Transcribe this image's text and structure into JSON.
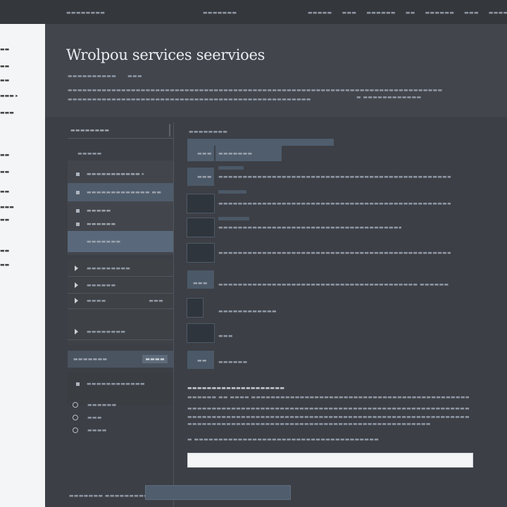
{
  "topbar": {
    "left": "▬▬▬▬▬▬▬▬",
    "center": "▬▬▬▬▬▬▬",
    "nav": [
      "▬▬▬▬▬",
      "▬▬▬",
      "▬▬▬▬▬▬",
      "▬▬",
      "▬▬▬▬▬▬",
      "▬▬▬",
      "▬▬▬▬▬▬▬"
    ]
  },
  "leftpane": {
    "items": [
      "▬▬",
      "▬▬",
      "▬▬",
      "▬▬▬ ▸",
      "▬▬▬",
      "▬▬",
      "▬▬",
      "▬▬",
      "▬▬▬",
      "▬▬",
      "▬▬",
      "▬▬"
    ]
  },
  "hero": {
    "title": "Wrolpou services seervioes",
    "meta1": "▬▬▬▬▬▬▬▬▬▬",
    "meta2": "▬▬▬",
    "para1": "▬▬▬▬▬▬▬▬▬▬▬▬▬▬▬▬▬▬▬▬▬▬▬▬▬▬▬▬▬▬▬▬▬▬▬▬▬▬▬▬▬▬▬▬▬▬▬▬▬▬▬▬▬▬▬▬▬▬▬▬▬▬▬▬▬▬▬▬▬▬▬▬▬▬▬▬▬",
    "para2": "▬▬▬▬▬▬▬▬▬▬▬▬▬▬▬▬▬▬▬▬▬▬▬▬▬▬▬▬▬▬▬▬▬▬▬▬▬▬▬▬▬▬▬▬▬▬▬▬▬▬",
    "para3": "▬ ▬▬▬▬▬▬▬▬▬▬▬▬"
  },
  "sidebar": {
    "header": "▬▬▬▬▬▬▬▬",
    "section": "▬▬▬▬▬",
    "items": [
      {
        "label": "▬▬▬▬▬▬▬▬▬▬▬ ▸"
      },
      {
        "label": "▬▬▬▬▬▬▬▬▬▬▬▬▬ ▬▬"
      },
      {
        "label": "▬▬▬▬▬"
      },
      {
        "label": "▬▬▬▬▬▬"
      },
      {
        "label": "▬▬▬▬▬▬▬"
      }
    ],
    "rows": [
      {
        "label": "▬▬▬▬▬▬▬▬▬",
        "right": ""
      },
      {
        "label": "▬▬▬▬▬▬",
        "right": ""
      },
      {
        "label": "▬▬▬▬",
        "right": "▬▬▬"
      },
      {
        "label": "▬▬▬▬▬▬▬▬",
        "right": ""
      }
    ],
    "button_left": "▬▬▬▬▬▬▬",
    "button_right": "▬▬▬▬",
    "sub": [
      {
        "label": "▬▬▬▬▬▬▬▬▬▬▬▬"
      },
      {
        "label": "▬▬▬▬▬▬"
      },
      {
        "label": "▬▬▬"
      },
      {
        "label": "▬▬▬▬"
      }
    ]
  },
  "content": {
    "title": "▬▬▬▬▬▬▬▬",
    "first_label": "▬▬▬▬▬▬▬",
    "first_thumb": "▬▬▬",
    "rows": [
      {
        "thumb": "▬▬▬",
        "label": "▬▬▬▬▬▬▬▬▬▬▬▬▬▬▬▬▬▬▬▬▬▬▬▬▬▬▬▬▬▬▬▬▬▬▬▬▬▬▬▬▬▬▬▬▬▬▬▬▬▬▬▬▬▬▬▬▬▬▬"
      },
      {
        "thumb": "",
        "label": "▬▬▬▬▬▬▬▬▬▬▬▬▬▬▬▬▬▬▬▬▬▬▬▬▬▬▬▬▬▬▬▬▬▬▬▬▬▬▬▬▬▬▬▬▬▬▬▬▬▬▬▬▬▬▬"
      },
      {
        "thumb": "",
        "label": "▬▬▬▬▬▬▬▬▬▬▬▬▬▬▬▬▬▬▬▬▬▬▬▬▬▬▬▬▬▬▬▬▬▬▬▬▬▬▬▬▬▬▬"
      },
      {
        "thumb": "",
        "label": "▬▬▬▬▬▬▬▬▬▬▬▬▬▬▬▬▬▬▬▬▬▬▬▬▬▬▬▬▬▬▬▬▬▬▬▬▬▬▬▬▬▬▬▬▬▬▬▬▬▬▬▬▬▬▬▬▬"
      },
      {
        "thumb": "▬▬▬",
        "label": "▬▬▬▬▬▬▬▬▬▬▬▬▬▬▬▬▬▬▬▬▬▬▬▬▬▬▬▬▬▬▬▬▬▬▬▬▬▬▬▬▬ ▬▬▬▬▬▬"
      },
      {
        "thumb": "",
        "label": "▬▬▬▬▬▬▬▬▬▬▬▬"
      },
      {
        "thumb": "",
        "label": "▬▬▬"
      },
      {
        "thumb": "▬▬",
        "label": "▬▬▬▬▬▬"
      }
    ],
    "bullet": "▬▬▬▬▬▬▬▬▬▬▬▬▬▬▬▬▬▬▬▬",
    "paras": [
      "▬▬▬▬▬▬ ▬▬ ▬▬▬▬ ▬▬▬▬▬▬▬▬▬▬▬▬▬▬▬▬▬▬▬▬▬▬▬▬▬▬▬▬▬▬▬▬▬▬▬▬▬▬▬▬▬▬▬▬▬",
      "▬▬▬▬▬▬▬▬▬▬▬▬▬▬▬▬▬▬▬▬▬▬▬▬▬▬▬▬▬▬▬▬▬▬▬▬▬▬▬▬▬▬▬▬▬▬▬▬▬▬▬▬▬▬▬▬▬▬▬▬▬▬▬▬",
      "▬▬▬▬▬▬▬▬▬▬▬▬▬▬▬▬▬▬▬▬▬▬▬▬▬▬▬▬▬▬▬▬▬▬▬▬▬▬▬▬▬▬▬▬▬▬▬▬▬▬▬▬▬▬▬▬▬▬▬▬▬▬▬▬▬▬▬▬▬▬▬",
      "▬▬▬▬▬▬▬▬▬▬▬▬▬▬▬▬▬▬▬▬▬▬▬▬▬▬▬▬▬▬▬▬▬▬▬▬▬▬▬▬▬▬▬▬▬▬▬▬▬▬"
    ],
    "bullet2": "▬ ▬▬▬▬▬▬▬▬▬▬▬▬▬▬▬▬▬▬▬▬▬▬▬▬▬▬▬▬▬▬▬▬▬▬▬▬▬▬",
    "input_value": "",
    "footer": "▬▬▬▬▬▬▬ ▬▬▬▬▬▬▬▬▬▬"
  },
  "colors": {
    "accent": "#4f5d6d",
    "background": "#3a3d43",
    "left_pane": "#f4f5f6"
  }
}
